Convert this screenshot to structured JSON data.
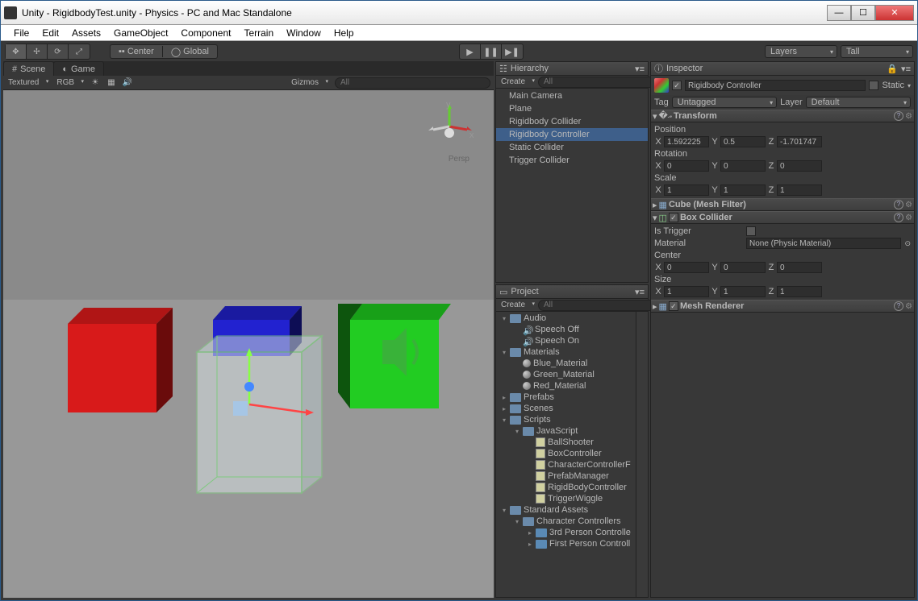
{
  "window": {
    "title": "Unity - RigidbodyTest.unity - Physics - PC and Mac Standalone"
  },
  "menubar": [
    "File",
    "Edit",
    "Assets",
    "GameObject",
    "Component",
    "Terrain",
    "Window",
    "Help"
  ],
  "toolbar": {
    "center": "Center",
    "global": "Global",
    "layers": "Layers",
    "layout": "Tall"
  },
  "scene": {
    "tab_scene": "Scene",
    "tab_game": "Game",
    "shading": "Textured",
    "rendermode": "RGB",
    "gizmos": "Gizmos",
    "search_ph": "All",
    "persp": "Persp",
    "axis_x": "x",
    "axis_y": "y",
    "axis_z": "z"
  },
  "hierarchy": {
    "title": "Hierarchy",
    "create": "Create",
    "search_ph": "All",
    "items": [
      "Main Camera",
      "Plane",
      "Rigidbody Collider",
      "Rigidbody Controller",
      "Static Collider",
      "Trigger Collider"
    ],
    "selected_index": 3
  },
  "project": {
    "title": "Project",
    "create": "Create",
    "search_ph": "All",
    "tree": [
      {
        "indent": 0,
        "arrow": "▾",
        "kind": "folder",
        "label": "Audio",
        "trunc": true
      },
      {
        "indent": 1,
        "arrow": "",
        "kind": "sound",
        "label": "Speech Off"
      },
      {
        "indent": 1,
        "arrow": "",
        "kind": "sound",
        "label": "Speech On"
      },
      {
        "indent": 0,
        "arrow": "▾",
        "kind": "folder",
        "label": "Materials"
      },
      {
        "indent": 1,
        "arrow": "",
        "kind": "mat",
        "label": "Blue_Material"
      },
      {
        "indent": 1,
        "arrow": "",
        "kind": "mat",
        "label": "Green_Material"
      },
      {
        "indent": 1,
        "arrow": "",
        "kind": "mat",
        "label": "Red_Material"
      },
      {
        "indent": 0,
        "arrow": "▸",
        "kind": "folder",
        "label": "Prefabs"
      },
      {
        "indent": 0,
        "arrow": "▸",
        "kind": "folder",
        "label": "Scenes"
      },
      {
        "indent": 0,
        "arrow": "▾",
        "kind": "folder",
        "label": "Scripts"
      },
      {
        "indent": 1,
        "arrow": "▾",
        "kind": "folder",
        "label": "JavaScript"
      },
      {
        "indent": 2,
        "arrow": "",
        "kind": "script",
        "label": "BallShooter"
      },
      {
        "indent": 2,
        "arrow": "",
        "kind": "script",
        "label": "BoxController"
      },
      {
        "indent": 2,
        "arrow": "",
        "kind": "script",
        "label": "CharacterControllerF"
      },
      {
        "indent": 2,
        "arrow": "",
        "kind": "script",
        "label": "PrefabManager"
      },
      {
        "indent": 2,
        "arrow": "",
        "kind": "script",
        "label": "RigidBodyController"
      },
      {
        "indent": 2,
        "arrow": "",
        "kind": "script",
        "label": "TriggerWiggle"
      },
      {
        "indent": 0,
        "arrow": "▾",
        "kind": "folder",
        "label": "Standard Assets"
      },
      {
        "indent": 1,
        "arrow": "▾",
        "kind": "folder",
        "label": "Character Controllers"
      },
      {
        "indent": 2,
        "arrow": "▸",
        "kind": "prefab",
        "label": "3rd Person Controlle"
      },
      {
        "indent": 2,
        "arrow": "▸",
        "kind": "prefab",
        "label": "First Person Controll"
      }
    ]
  },
  "inspector": {
    "title": "Inspector",
    "object_name": "Rigidbody Controller",
    "static_label": "Static",
    "tag_label": "Tag",
    "tag_value": "Untagged",
    "layer_label": "Layer",
    "layer_value": "Default",
    "transform": {
      "title": "Transform",
      "position_label": "Position",
      "rotation_label": "Rotation",
      "scale_label": "Scale",
      "pos": {
        "x": "1.592225",
        "y": "0.5",
        "z": "-1.701747"
      },
      "rot": {
        "x": "0",
        "y": "0",
        "z": "0"
      },
      "scale": {
        "x": "1",
        "y": "1",
        "z": "1"
      }
    },
    "meshfilter": {
      "title": "Cube (Mesh Filter)"
    },
    "boxcollider": {
      "title": "Box Collider",
      "istrigger_label": "Is Trigger",
      "material_label": "Material",
      "material_value": "None (Physic Material)",
      "center_label": "Center",
      "size_label": "Size",
      "center": {
        "x": "0",
        "y": "0",
        "z": "0"
      },
      "size": {
        "x": "1",
        "y": "1",
        "z": "1"
      }
    },
    "meshrenderer": {
      "title": "Mesh Renderer"
    }
  },
  "labels": {
    "x": "X",
    "y": "Y",
    "z": "Z"
  }
}
